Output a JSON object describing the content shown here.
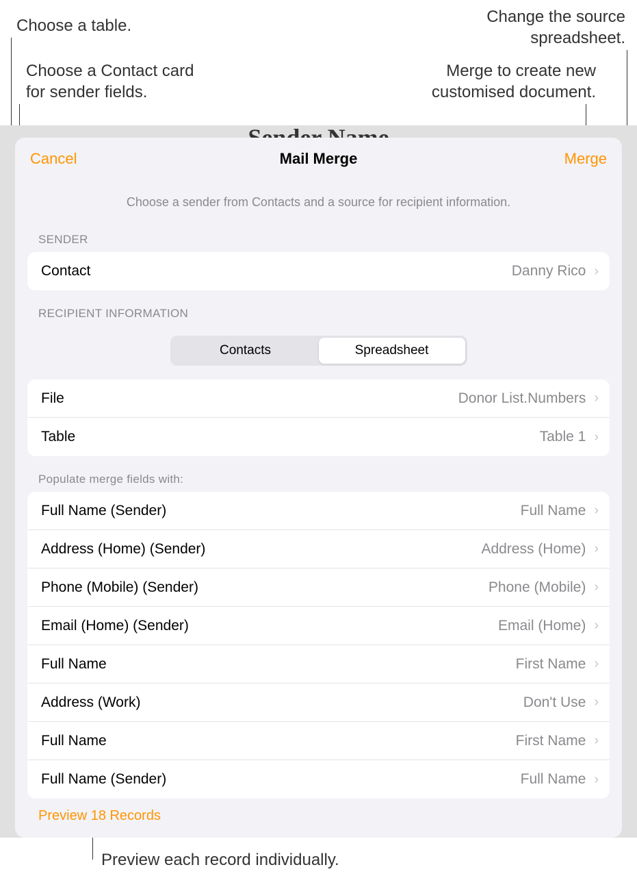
{
  "callouts": {
    "top_left": "Choose a table.",
    "mid_left_1": "Choose a Contact card",
    "mid_left_2": "for sender fields.",
    "top_right_1": "Change the source",
    "top_right_2": "spreadsheet.",
    "mid_right_1": "Merge to create new",
    "mid_right_2": "customised document.",
    "bottom": "Preview each record individually."
  },
  "backdrop_title": "Sender Name",
  "sheet": {
    "cancel": "Cancel",
    "title": "Mail Merge",
    "merge": "Merge",
    "subtitle": "Choose a sender from Contacts and a source for recipient information."
  },
  "sender": {
    "header": "Sender",
    "contact_label": "Contact",
    "contact_value": "Danny Rico"
  },
  "recipient": {
    "header": "Recipient Information",
    "seg_contacts": "Contacts",
    "seg_spreadsheet": "Spreadsheet",
    "file_label": "File",
    "file_value": "Donor List.Numbers",
    "table_label": "Table",
    "table_value": "Table 1"
  },
  "fields": {
    "header": "Populate merge fields with:",
    "rows": [
      {
        "label": "Full Name (Sender)",
        "value": "Full Name"
      },
      {
        "label": "Address (Home) (Sender)",
        "value": "Address (Home)"
      },
      {
        "label": "Phone (Mobile) (Sender)",
        "value": "Phone (Mobile)"
      },
      {
        "label": "Email (Home) (Sender)",
        "value": "Email (Home)"
      },
      {
        "label": "Full Name",
        "value": "First Name"
      },
      {
        "label": "Address (Work)",
        "value": "Don't Use"
      },
      {
        "label": "Full Name",
        "value": "First Name"
      },
      {
        "label": "Full Name (Sender)",
        "value": "Full Name"
      }
    ]
  },
  "preview": "Preview 18 Records"
}
